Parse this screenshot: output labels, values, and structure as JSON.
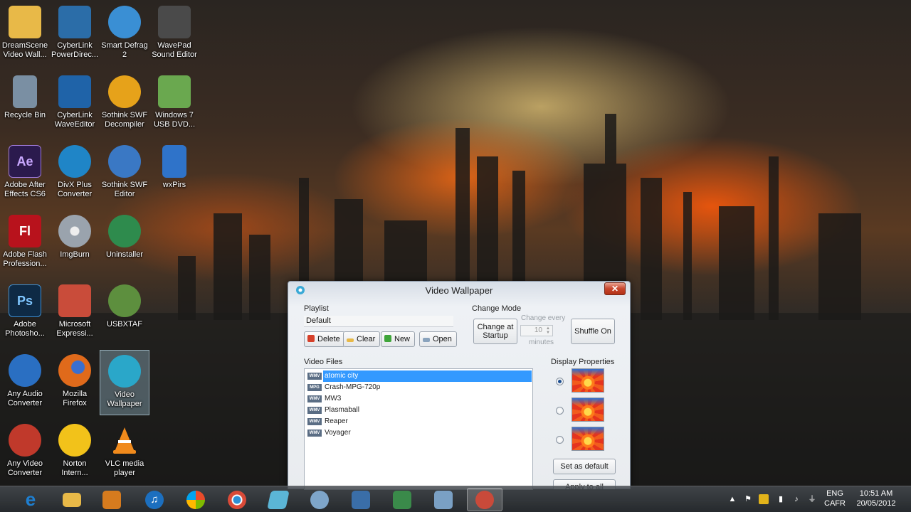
{
  "desktop": {
    "icons": [
      {
        "label": "DreamScene Video Wall...",
        "icon": "dreamscene-icon",
        "color": "#e8b948"
      },
      {
        "label": "CyberLink PowerDirec...",
        "icon": "powerdirector-icon",
        "color": "#2b6da8"
      },
      {
        "label": "Smart Defrag 2",
        "icon": "smart-defrag-icon",
        "color": "#3a8fd4"
      },
      {
        "label": "WavePad Sound Editor",
        "icon": "wavepad-icon",
        "color": "#4a4a4a"
      },
      {
        "label": "Recycle Bin",
        "icon": "recycle-bin-icon",
        "color": "#7a8fa3"
      },
      {
        "label": "CyberLink WaveEditor",
        "icon": "waveeditor-icon",
        "color": "#1f63a8"
      },
      {
        "label": "Sothink SWF Decompiler",
        "icon": "sothink-decompiler-icon",
        "color": "#e6a21a"
      },
      {
        "label": "Windows 7 USB DVD...",
        "icon": "usb-dvd-tool-icon",
        "color": "#6aa84f"
      },
      {
        "label": "Adobe After Effects CS6",
        "icon": "after-effects-icon",
        "color": "#2b1a4d"
      },
      {
        "label": "DivX Plus Converter",
        "icon": "divx-icon",
        "color": "#1f85c7"
      },
      {
        "label": "Sothink SWF Editor",
        "icon": "sothink-editor-icon",
        "color": "#3a78c4"
      },
      {
        "label": "wxPirs",
        "icon": "wxpirs-icon",
        "color": "#2f73c9"
      },
      {
        "label": "Adobe Flash Profession...",
        "icon": "flash-icon",
        "color": "#b8121c"
      },
      {
        "label": "ImgBurn",
        "icon": "imgburn-icon",
        "color": "#9aa3ad"
      },
      {
        "label": "Uninstaller",
        "icon": "uninstaller-icon",
        "color": "#2e8b4d"
      },
      {
        "label": "Adobe Photosho...",
        "icon": "photoshop-icon",
        "color": "#0e2a45"
      },
      {
        "label": "Microsoft Expressi...",
        "icon": "expression-icon",
        "color": "#c94c3a"
      },
      {
        "label": "USBXTAF",
        "icon": "usbxtaf-icon",
        "color": "#5d8f3e"
      },
      {
        "label": "Any Audio Converter",
        "icon": "audio-converter-icon",
        "color": "#2a6fc2"
      },
      {
        "label": "Mozilla Firefox",
        "icon": "firefox-icon",
        "color": "#e06a1b"
      },
      {
        "label": "Video Wallpaper",
        "icon": "video-wallpaper-icon",
        "color": "#2aa7c9"
      },
      {
        "label": "Any Video Converter",
        "icon": "video-converter-icon",
        "color": "#c0392b"
      },
      {
        "label": "Norton Intern...",
        "icon": "norton-icon",
        "color": "#f2c21a"
      },
      {
        "label": "VLC media player",
        "icon": "vlc-icon",
        "color": "#f08a1c"
      }
    ],
    "icon_glyphs": {
      "after-effects-icon": "Ae",
      "flash-icon": "Fl",
      "photoshop-icon": "Ps"
    }
  },
  "window": {
    "title": "Video Wallpaper",
    "close_label": "✕",
    "playlist_label": "Playlist",
    "playlist_value": "Default",
    "buttons": {
      "delete": "Delete",
      "clear": "Clear",
      "new": "New",
      "open": "Open"
    },
    "change_mode_label": "Change Mode",
    "change_at_startup": "Change at Startup",
    "change_every_label": "Change every",
    "change_every_value": "10",
    "minutes_label": "minutes",
    "shuffle_label": "Shuffle On",
    "video_files_label": "Video Files",
    "display_properties_label": "Display Properties",
    "files": [
      {
        "type": "WMV",
        "name": "atomic city",
        "selected": true
      },
      {
        "type": "MPG",
        "name": "Crash-MPG-720p",
        "selected": false
      },
      {
        "type": "WMV",
        "name": "MW3",
        "selected": false
      },
      {
        "type": "WMV",
        "name": "Plasmaball",
        "selected": false
      },
      {
        "type": "WMV",
        "name": "Reaper",
        "selected": false
      },
      {
        "type": "WMV",
        "name": "Voyager",
        "selected": false
      }
    ],
    "display_options": [
      {
        "selected": true
      },
      {
        "selected": false
      },
      {
        "selected": false
      }
    ],
    "set_default": "Set as default",
    "apply_all": "Apply to all"
  },
  "taskbar": {
    "apps": [
      {
        "icon": "internet-explorer-icon",
        "color": "#1e7fd1",
        "active": false
      },
      {
        "icon": "file-explorer-icon",
        "color": "#e8b948",
        "active": false
      },
      {
        "icon": "media-center-icon",
        "color": "#d67b1e",
        "active": false
      },
      {
        "icon": "itunes-icon",
        "color": "#1c6fbf",
        "active": false
      },
      {
        "icon": "windows-store-icon",
        "color": "#3f9b3a",
        "active": false
      },
      {
        "icon": "chrome-icon",
        "color": "#2d8fd6",
        "active": false
      },
      {
        "icon": "notepad-icon",
        "color": "#5bb5d6",
        "active": false
      },
      {
        "icon": "paint-icon",
        "color": "#7ea5c9",
        "active": false
      },
      {
        "icon": "calculator-icon",
        "color": "#3a6ea8",
        "active": false
      },
      {
        "icon": "spreadsheet-icon",
        "color": "#3a8a4a",
        "active": false
      },
      {
        "icon": "control-panel-icon",
        "color": "#7aa0c4",
        "active": false
      },
      {
        "icon": "video-wallpaper-taskbar-icon",
        "color": "#c94a3a",
        "active": true
      }
    ],
    "language_top": "ENG",
    "language_bottom": "CAFR",
    "time": "10:51 AM",
    "date": "20/05/2012"
  }
}
